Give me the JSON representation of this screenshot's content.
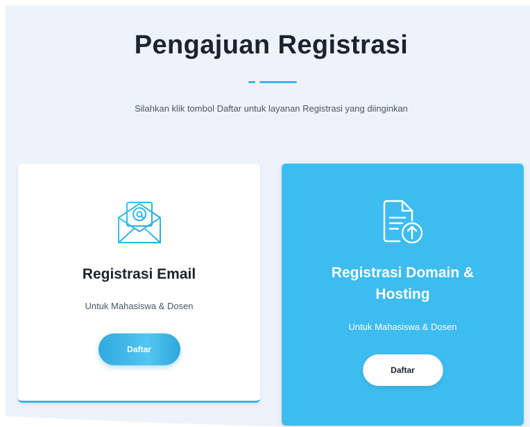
{
  "header": {
    "title": "Pengajuan Registrasi",
    "subtitle": "Silahkan klik tombol Daftar untuk layanan Registrasi yang diinginkan"
  },
  "cards": [
    {
      "icon": "email-icon",
      "title": "Registrasi Email",
      "subtitle": "Untuk Mahasiswa & Dosen",
      "button_label": "Daftar"
    },
    {
      "icon": "document-upload-icon",
      "title": "Registrasi Domain & Hosting",
      "subtitle": "Untuk Mahasiswa & Dosen",
      "button_label": "Daftar"
    }
  ],
  "colors": {
    "accent": "#3ab6e7",
    "card_highlight": "#3dbcf0",
    "page_background": "#eef3fb",
    "heading_text": "#1b2230"
  }
}
